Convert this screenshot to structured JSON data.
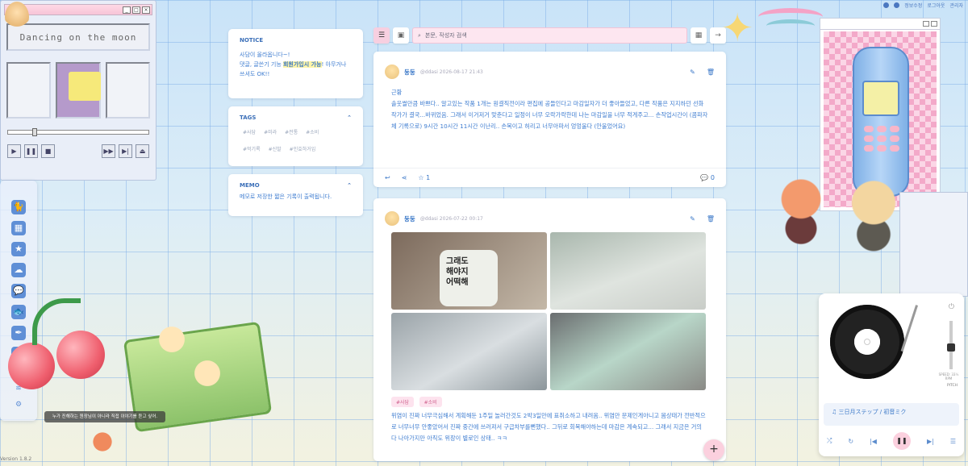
{
  "topbar": {
    "items": [
      "정보수정",
      "로그아웃",
      "관리자"
    ]
  },
  "winamp": {
    "display_text": "Dancing on the moon"
  },
  "notice": {
    "title": "NOTICE",
    "line1": "사담이 올라옵니다~!",
    "line2_pre": "댓글, 글쓴기 기능 ",
    "line2_hl": "회원가입시 가능",
    "line2_post": "! 아무거나 쓰셔도 OK!!"
  },
  "tags": {
    "title": "TAGS",
    "items": [
      "#사담",
      "#미라",
      "#전통",
      "#소비",
      "#먹기록",
      "#신발",
      "#인효하거임"
    ]
  },
  "memo": {
    "title": "MEMO",
    "body": "메모로 저장한 짧은 기록이 출력됩니다."
  },
  "search": {
    "placeholder": "본문, 작성자 검색"
  },
  "post1": {
    "author": "둥둥",
    "meta": "@ddasi 2026-08-17 21:43",
    "title": "근황",
    "body": "솔웃썰만큼 바쁘다.. 알고있는 작품 1개는 원결직전이라 편집에 공들인다고 마감일자가 더 좋아들었고, 다른 작품은 지지하던 선화작가가 결국...바뀌었음. 그래서 이거저거 맞춘다고 일정이 너무 오락가락한데 나는 마감일을 너무 적게주고... 손작업시간이 (콤파자체 기록으로) 9시간 10시간 11시간 이난리.. 손목이고 허리고 너무아파서 엉엉울다 (안울었어요)",
    "likes": "1",
    "comments": "0"
  },
  "post2": {
    "author": "둥둥",
    "meta": "@ddasi 2026-07-22 00:17",
    "photo_text": "그래도\n해야지\n어떡해",
    "tags": [
      "#사담",
      "#소비"
    ],
    "body": "위염이 진짜 너무극심해서 계획해둔 1주일 놀러간것도 2박3일만에 표취소하고 내려옴.. 위염만 문제인게아니고 몸상태가 전반적으로 너무너무 안좋았어서 진짜 중간에 쓰러져서 구급차부를뻔했다.. 그뒤로 회복해야하는데 마감은 계속되고... 그래서 지금은 거의 다 나아가지만 아직도 위장이 별로인 상태.. ㅋㅋ"
  },
  "tooltip": {
    "text": "누가 진해하는 원장님이 아니라 직접 이야기를 듣고 싶어."
  },
  "player": {
    "song": "三日月ステップ / 初音ミク",
    "speed_label": "SPEED: 33½ RPM",
    "pitch_label": "PITCH"
  },
  "version": {
    "text": "Version 1.8.2"
  },
  "colors": {
    "accent": "#3b78c8",
    "pink": "#f7cfe0"
  }
}
